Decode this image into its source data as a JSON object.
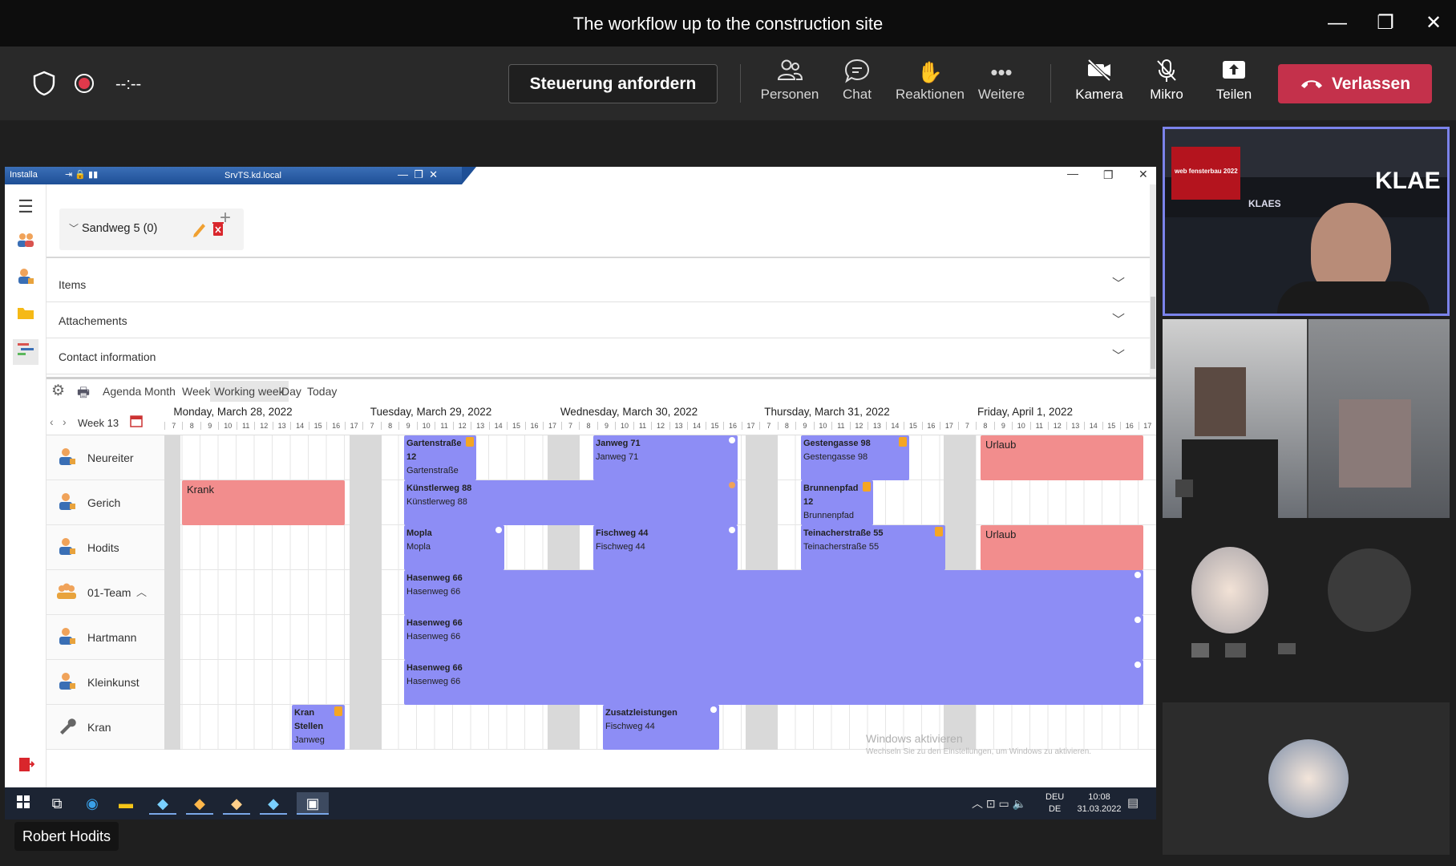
{
  "window": {
    "title": "The workflow up to the construction site",
    "minimize": "—",
    "maximize": "❐",
    "close": "✕"
  },
  "toolbar": {
    "timer": "--:--",
    "control_request": "Steuerung anfordern",
    "people": "Personen",
    "chat": "Chat",
    "reactions": "Reaktionen",
    "more": "Weitere",
    "camera": "Kamera",
    "mic": "Mikro",
    "share": "Teilen",
    "leave": "Verlassen",
    "leave_color": "#c4314b"
  },
  "remote": {
    "app_label": "Installa",
    "host": "SrvTS.kd.local"
  },
  "project": {
    "name": "Sandweg 5 (0)"
  },
  "sections": [
    "Items",
    "Attachements",
    "Contact information"
  ],
  "calendar": {
    "views": [
      "Agenda",
      "Month",
      "Week",
      "Working week",
      "Day",
      "Today"
    ],
    "active_view": "Working week",
    "week_label": "Week 13",
    "days": [
      "Monday, March 28, 2022",
      "Tuesday, March 29, 2022",
      "Wednesday, March 30, 2022",
      "Thursday, March 31, 2022",
      "Friday, April 1, 2022"
    ],
    "hours": [
      "7",
      "8",
      "9",
      "10",
      "11",
      "12",
      "13",
      "14",
      "15",
      "16",
      "17"
    ],
    "resources": [
      {
        "name": "Neureiter",
        "icon": "worker-icon"
      },
      {
        "name": "Gerich",
        "icon": "worker-icon"
      },
      {
        "name": "Hodits",
        "icon": "worker-icon"
      },
      {
        "name": "01-Team",
        "icon": "team-icon"
      },
      {
        "name": "Hartmann",
        "icon": "worker-icon"
      },
      {
        "name": "Kleinkunst",
        "icon": "worker-icon"
      },
      {
        "name": "Kran",
        "icon": "wrench-icon"
      }
    ],
    "events": {
      "gartenstrasse": [
        "Gartenstraße",
        "12",
        "Gartenstraße"
      ],
      "janweg": [
        "Janweg 71",
        "Janweg 71"
      ],
      "gestengasse": [
        "Gestengasse 98",
        "Gestengasse 98"
      ],
      "urlaub1": "Urlaub",
      "krank": "Krank",
      "kuenstlerweg": [
        "Künstlerweg 88",
        "Künstlerweg 88"
      ],
      "brunnenpfad": [
        "Brunnenpfad",
        "12",
        "Brunnenpfad"
      ],
      "mopla": [
        "Mopla",
        "Mopla"
      ],
      "fischweg": [
        "Fischweg 44",
        "Fischweg 44"
      ],
      "teinacher": [
        "Teinacherstraße 55",
        "Teinacherstraße 55"
      ],
      "urlaub2": "Urlaub",
      "hasenweg1": [
        "Hasenweg 66",
        "Hasenweg 66"
      ],
      "hasenweg2": [
        "Hasenweg 66",
        "Hasenweg 66"
      ],
      "hasenweg3": [
        "Hasenweg 66",
        "Hasenweg 66"
      ],
      "kran": [
        "Kran",
        "Stellen",
        "Janweg"
      ],
      "zusatz": [
        "Zusatzleistungen",
        "Fischweg 44"
      ]
    },
    "event_color": "#8d8df5",
    "absence_color": "#f28d8d"
  },
  "watermark": {
    "title": "Windows aktivieren",
    "sub": "Wechseln Sie zu den Einstellungen, um Windows zu aktivieren."
  },
  "taskbar": {
    "lang1": "DEU",
    "lang2": "DE",
    "time": "10:08",
    "date": "31.03.2022"
  },
  "presenter": "Robert Hodits",
  "video": {
    "banner_text": "KLAE",
    "logo_text": "KLAES",
    "sign_text": "web fensterbau 2022"
  }
}
